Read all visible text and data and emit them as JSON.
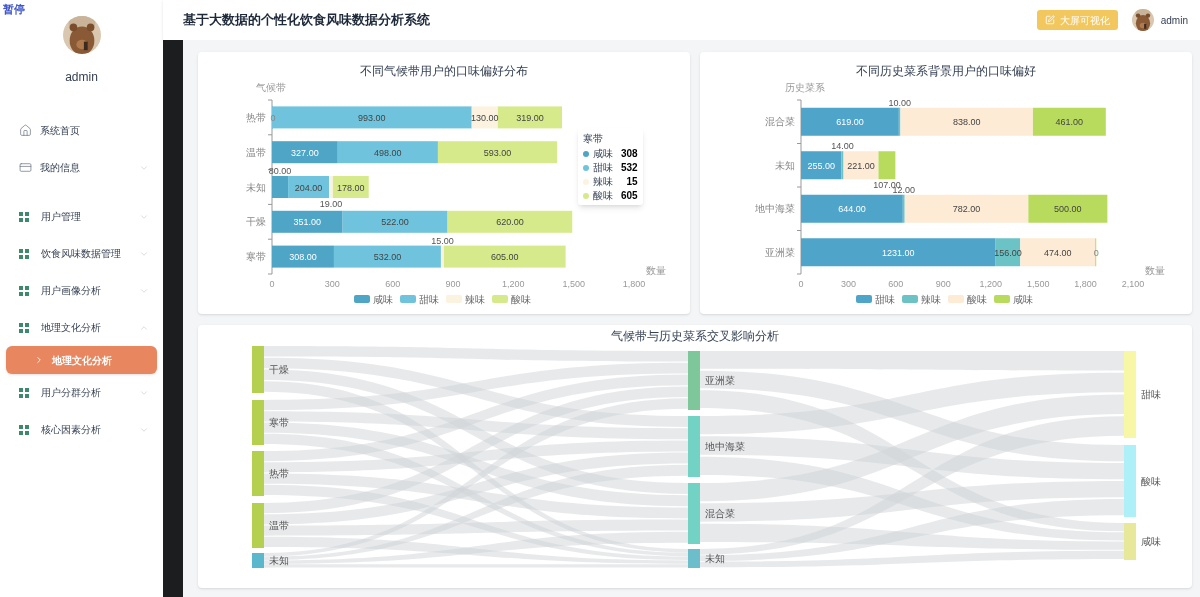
{
  "overlay_label": "暂停",
  "sidebar": {
    "user": {
      "name": "admin"
    },
    "sections": [
      [
        {
          "kind": "home",
          "label": "系统首页"
        },
        {
          "kind": "info",
          "label": "我的信息",
          "expanded": false
        }
      ],
      [
        {
          "kind": "group",
          "label": "用户管理",
          "expanded": false
        },
        {
          "kind": "group",
          "label": "饮食风味数据管理",
          "expanded": false
        },
        {
          "kind": "group",
          "label": "用户画像分析",
          "expanded": false
        },
        {
          "kind": "group",
          "label": "地理文化分析",
          "expanded": true,
          "children": [
            {
              "label": "地理文化分析",
              "selected": true
            }
          ]
        },
        {
          "kind": "group",
          "label": "用户分群分析",
          "expanded": false
        },
        {
          "kind": "group",
          "label": "核心因素分析",
          "expanded": false
        }
      ]
    ]
  },
  "header": {
    "title": "基于大数据的个性化饮食风味数据分析系统",
    "button": "大屏可视化",
    "user": "admin"
  },
  "charts": [
    {
      "chart_data": {
        "type": "bar",
        "orientation": "horizontal",
        "stacked": true,
        "data_labels": true,
        "legend": "bottom",
        "title": "不同气候带用户的口味偏好分布",
        "ylabel": "气候带",
        "xlabel": "数量",
        "categories": [
          "热带",
          "温带",
          "未知",
          "干燥",
          "寒带"
        ],
        "xlim": [
          0,
          1800
        ],
        "xticks": [
          0,
          300,
          600,
          900,
          {
            "value": 1200,
            "label": "1,200"
          },
          {
            "value": 1500,
            "label": "1,500"
          },
          {
            "value": 1800,
            "label": "1,800"
          }
        ],
        "series": [
          {
            "name": "咸味",
            "color": "#4ea5c6",
            "values": [
              0,
              327,
              80,
              351,
              308
            ],
            "value_labels": [
              "0",
              "327.00",
              "80.00",
              "351.00",
              "308.00"
            ]
          },
          {
            "name": "甜味",
            "color": "#6fc3dc",
            "values": [
              993,
              498,
              204,
              522,
              532
            ],
            "value_labels": [
              "993.00",
              "498.00",
              "204.00",
              "522.00",
              "532.00"
            ]
          },
          {
            "name": "辣味",
            "color": "#fbf3e0",
            "values": [
              130,
              null,
              19,
              null,
              15
            ],
            "value_labels": [
              "130.00",
              null,
              "19.00",
              null,
              "15.00"
            ]
          },
          {
            "name": "酸味",
            "color": "#d6ea8c",
            "values": [
              319,
              593,
              178,
              620,
              605
            ],
            "value_labels": [
              "319.00",
              "593.00",
              "178.00",
              "620.00",
              "605.00"
            ]
          }
        ]
      },
      "tooltip": {
        "title": "寒带",
        "items": [
          {
            "label": "咸味",
            "value": "308"
          },
          {
            "label": "甜味",
            "value": "532"
          },
          {
            "label": "辣味",
            "value": "15"
          },
          {
            "label": "酸味",
            "value": "605"
          }
        ]
      }
    },
    {
      "chart_data": {
        "type": "bar",
        "orientation": "horizontal",
        "stacked": true,
        "data_labels": true,
        "legend": "bottom",
        "title": "不同历史菜系背景用户的口味偏好",
        "ylabel": "历史菜系",
        "xlabel": "数量",
        "categories": [
          "混合菜",
          "未知",
          "地中海菜",
          "亚洲菜"
        ],
        "xlim": [
          0,
          2100
        ],
        "xticks": [
          0,
          300,
          600,
          900,
          {
            "value": 1200,
            "label": "1,200"
          },
          {
            "value": 1500,
            "label": "1,500"
          },
          {
            "value": 1800,
            "label": "1,800"
          },
          {
            "value": 2100,
            "label": "2,100"
          }
        ],
        "series": [
          {
            "name": "甜味",
            "color": "#4ea5c9",
            "values": [
              619,
              255,
              644,
              1231
            ],
            "value_labels": [
              "619.00",
              "255.00",
              "644.00",
              "1231.00"
            ]
          },
          {
            "name": "辣味",
            "color": "#6cc3c5",
            "values": [
              10,
              14,
              12,
              156
            ],
            "value_labels": [
              "10.00",
              "14.00",
              "12.00",
              "156.00"
            ]
          },
          {
            "name": "酸味",
            "color": "#fdebd5",
            "values": [
              838,
              221,
              782,
              474
            ],
            "value_labels": [
              "838.00",
              "221.00",
              "782.00",
              "474.00"
            ]
          },
          {
            "name": "咸味",
            "color": "#b9db5d",
            "values": [
              461,
              107,
              500,
              0
            ],
            "value_labels": [
              "461.00",
              "107.00",
              "500.00",
              "0"
            ]
          }
        ]
      }
    }
  ],
  "sankey": {
    "title": "气候带与历史菜系交叉影响分析",
    "columns": [
      [
        {
          "label": "干燥",
          "color": "#b5cf4e"
        },
        {
          "label": "寒带",
          "color": "#b5cf4e"
        },
        {
          "label": "热带",
          "color": "#b5cf4e"
        },
        {
          "label": "温带",
          "color": "#b5cf4e"
        },
        {
          "label": "未知",
          "color": "#5bb8cc"
        }
      ],
      [
        {
          "label": "亚洲菜",
          "color": "#7ec79a"
        },
        {
          "label": "地中海菜",
          "color": "#72d3c4"
        },
        {
          "label": "混合菜",
          "color": "#72d3c4"
        },
        {
          "label": "未知",
          "color": "#6dbecb"
        }
      ],
      [
        {
          "label": "甜味",
          "color": "#f7f7a6"
        },
        {
          "label": "酸味",
          "color": "#aef0f7"
        },
        {
          "label": "咸味",
          "color": "#e8e89a"
        }
      ]
    ]
  }
}
